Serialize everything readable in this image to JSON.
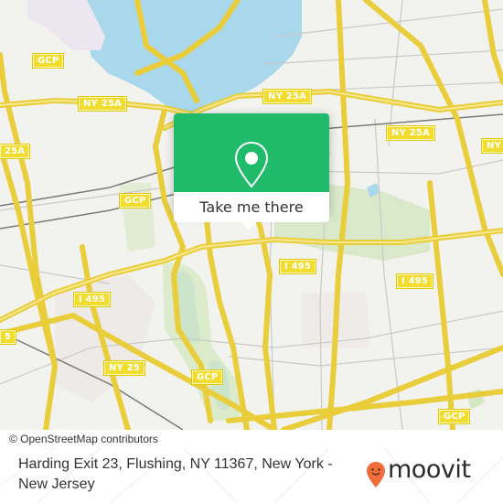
{
  "map": {
    "colors": {
      "land": "#f2f2ee",
      "water": "#a9d8ec",
      "park": "#d5e8c2",
      "road_major": "#f4e26a",
      "road_minor": "#c9c9c9",
      "rail": "#7a7a7a",
      "shield_bg": "#f2dd2e"
    },
    "shields": [
      {
        "label": "GCP"
      },
      {
        "label": "NY 25A"
      },
      {
        "label": "NY 25A"
      },
      {
        "label": "NY 25A"
      },
      {
        "label": "NY 25A"
      },
      {
        "label": "NY"
      },
      {
        "label": "GCP"
      },
      {
        "label": "I 495"
      },
      {
        "label": "I 495"
      },
      {
        "label": "I 495"
      },
      {
        "label": "NY 25"
      },
      {
        "label": "GCP"
      },
      {
        "label": "GCP"
      },
      {
        "label": "NY 25"
      },
      {
        "label": "5"
      },
      {
        "label": "25A"
      }
    ],
    "attribution": "© OpenStreetMap contributors"
  },
  "popup": {
    "button_label": "Take me there",
    "accent_color": "#1fba6a",
    "icon": "map-pin-icon"
  },
  "footer": {
    "address": "Harding Exit 23, Flushing, NY 11367, New York - New Jersey",
    "brand": "moovit",
    "brand_color": "#f26b3a"
  }
}
